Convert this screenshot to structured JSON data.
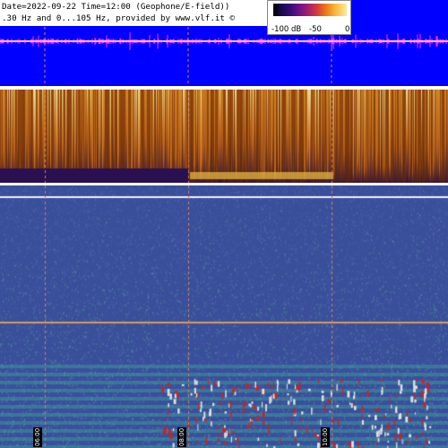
{
  "header": {
    "line1": "Date=2022-09-22 Time=12:00 (Geophone/E-field))",
    "line2": ".30 Hz and 0...105 Hz, provided by www.vlf.it ©"
  },
  "legend": {
    "labels": [
      "-100 dB",
      "-50",
      "0"
    ]
  },
  "time_axis": {
    "labels": [
      "06:00",
      "08:00",
      "10:00"
    ]
  },
  "colors": {
    "waveform_background": "#0000ff",
    "waveform_trace": "#ff33ff",
    "grid_lines": "#d08060",
    "top_spectrogram_base": "#6b2f04",
    "bottom_spectrogram_base": "#3a4f9a"
  }
}
